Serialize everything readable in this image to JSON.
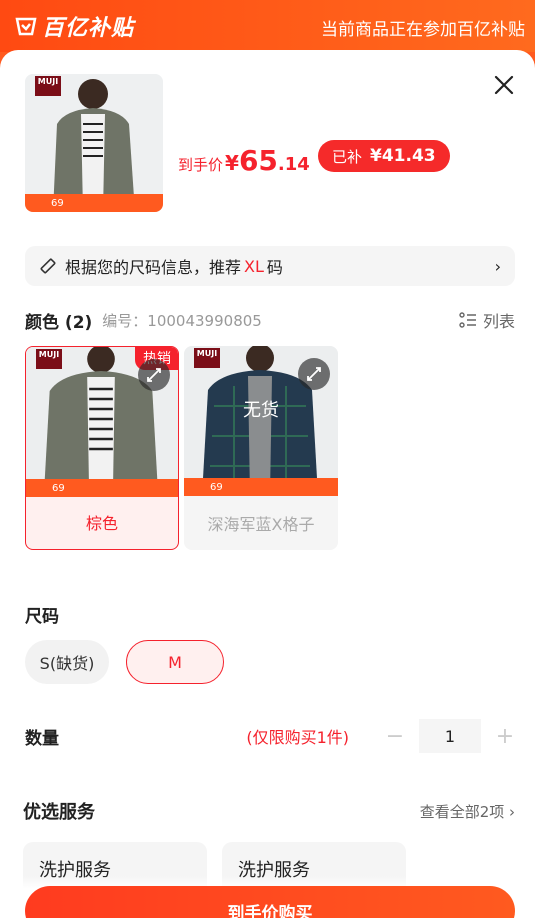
{
  "header": {
    "brand": "百亿补贴",
    "note": "当前商品正在参加百亿补贴"
  },
  "product": {
    "thumb_brand": "MUJI",
    "thumb_sticker_price": "69",
    "price_prefix": "到手价",
    "price_currency": "¥",
    "price_int": "65",
    "price_dec": ".14",
    "subsidy_label": "已补",
    "subsidy_value": "¥41.43"
  },
  "size_recommend": {
    "text_before": "根据您的尺码信息，推荐",
    "size": "XL",
    "text_after": "码"
  },
  "color": {
    "title": "颜色 (2)",
    "code": "编号：100043990805",
    "list_label": "列表",
    "options": [
      {
        "label": "棕色",
        "badge": "热销",
        "sticker_price": "69",
        "selected": true
      },
      {
        "label": "深海军蓝X格子",
        "status": "无货",
        "sticker_price": "69",
        "selected": false
      }
    ]
  },
  "size": {
    "title": "尺码",
    "options": [
      {
        "label": "S(缺货)"
      },
      {
        "label": "M"
      }
    ]
  },
  "quantity": {
    "title": "数量",
    "limit": "(仅限购买1件)",
    "value": "1",
    "minus": "−",
    "plus": "+"
  },
  "services": {
    "title": "优选服务",
    "view_all": "查看全部2项 ›",
    "items": [
      {
        "label": "洗护服务"
      },
      {
        "label": "洗护服务"
      }
    ]
  },
  "buy_button": "到手价购买",
  "colors": {
    "accent": "#f5222d",
    "orange": "#ff5a1f"
  }
}
